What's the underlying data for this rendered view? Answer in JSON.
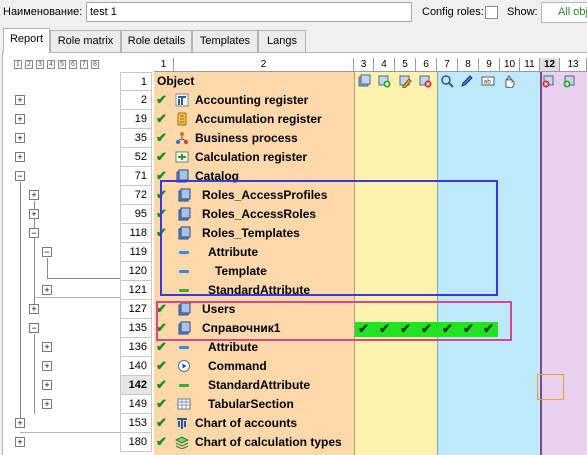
{
  "topbar": {
    "name_label": "Наименование:",
    "name_value": "test 1",
    "config_roles_label": "Config roles:",
    "show_label": "Show:",
    "show_value": "All objects"
  },
  "tabs": [
    "Report",
    "Role matrix",
    "Role details",
    "Templates",
    "Langs"
  ],
  "active_tab": "Report",
  "level_buttons": [
    "1",
    "2",
    "3",
    "4",
    "5",
    "6",
    "7",
    "8"
  ],
  "column_headers": {
    "c1": "1",
    "c2": "2",
    "rights": [
      "3",
      "4",
      "5",
      "6",
      "7",
      "8",
      "9",
      "10",
      "11",
      "12",
      "13"
    ]
  },
  "highlighted_column": "12",
  "header_row": {
    "num": "1",
    "label": "Object"
  },
  "rows": [
    {
      "num": "2",
      "label": "Accounting register",
      "checked": true,
      "icon": "accounting-register-icon"
    },
    {
      "num": "19",
      "label": "Accumulation register",
      "checked": true,
      "icon": "accumulation-register-icon"
    },
    {
      "num": "35",
      "label": "Business process",
      "checked": true,
      "icon": "business-process-icon"
    },
    {
      "num": "52",
      "label": "Calculation register",
      "checked": true,
      "icon": "calculation-register-icon"
    },
    {
      "num": "71",
      "label": "Catalog",
      "checked": true,
      "icon": "catalog-icon"
    },
    {
      "num": "72",
      "label": "Roles_AccessProfiles",
      "checked": true,
      "icon": "catalog-icon"
    },
    {
      "num": "95",
      "label": "Roles_AccessRoles",
      "checked": true,
      "icon": "catalog-icon"
    },
    {
      "num": "118",
      "label": "Roles_Templates",
      "checked": true,
      "icon": "catalog-icon"
    },
    {
      "num": "119",
      "label": "Attribute",
      "checked": false,
      "icon": "attribute-icon"
    },
    {
      "num": "120",
      "label": "Template",
      "checked": false,
      "icon": "attribute-icon"
    },
    {
      "num": "121",
      "label": "StandardAttribute",
      "checked": false,
      "icon": "standard-attribute-icon"
    },
    {
      "num": "127",
      "label": "Users",
      "checked": true,
      "icon": "catalog-icon"
    },
    {
      "num": "135",
      "label": "Справочник1",
      "checked": true,
      "icon": "catalog-icon"
    },
    {
      "num": "136",
      "label": "Attribute",
      "checked": true,
      "icon": "attribute-icon"
    },
    {
      "num": "140",
      "label": "Command",
      "checked": true,
      "icon": "command-icon"
    },
    {
      "num": "142",
      "label": "StandardAttribute",
      "checked": true,
      "icon": "standard-attribute-icon"
    },
    {
      "num": "149",
      "label": "TabularSection",
      "checked": true,
      "icon": "tabular-section-icon"
    },
    {
      "num": "153",
      "label": "Chart of accounts",
      "checked": true,
      "icon": "chart-of-accounts-icon"
    },
    {
      "num": "180",
      "label": "Chart of calculation types",
      "checked": true,
      "icon": "chart-of-calculation-types-icon"
    }
  ],
  "colors": {
    "object_col": "#fcd8aa",
    "rights_yellow": "#fdf1b0",
    "rights_blue": "#bfe9fb",
    "rights_purple": "#e8d0ef",
    "granted": "#22e322",
    "check_green": "#1e8a1e",
    "blue_frame": "#3a3adb",
    "pink_frame": "#d24a8c"
  }
}
